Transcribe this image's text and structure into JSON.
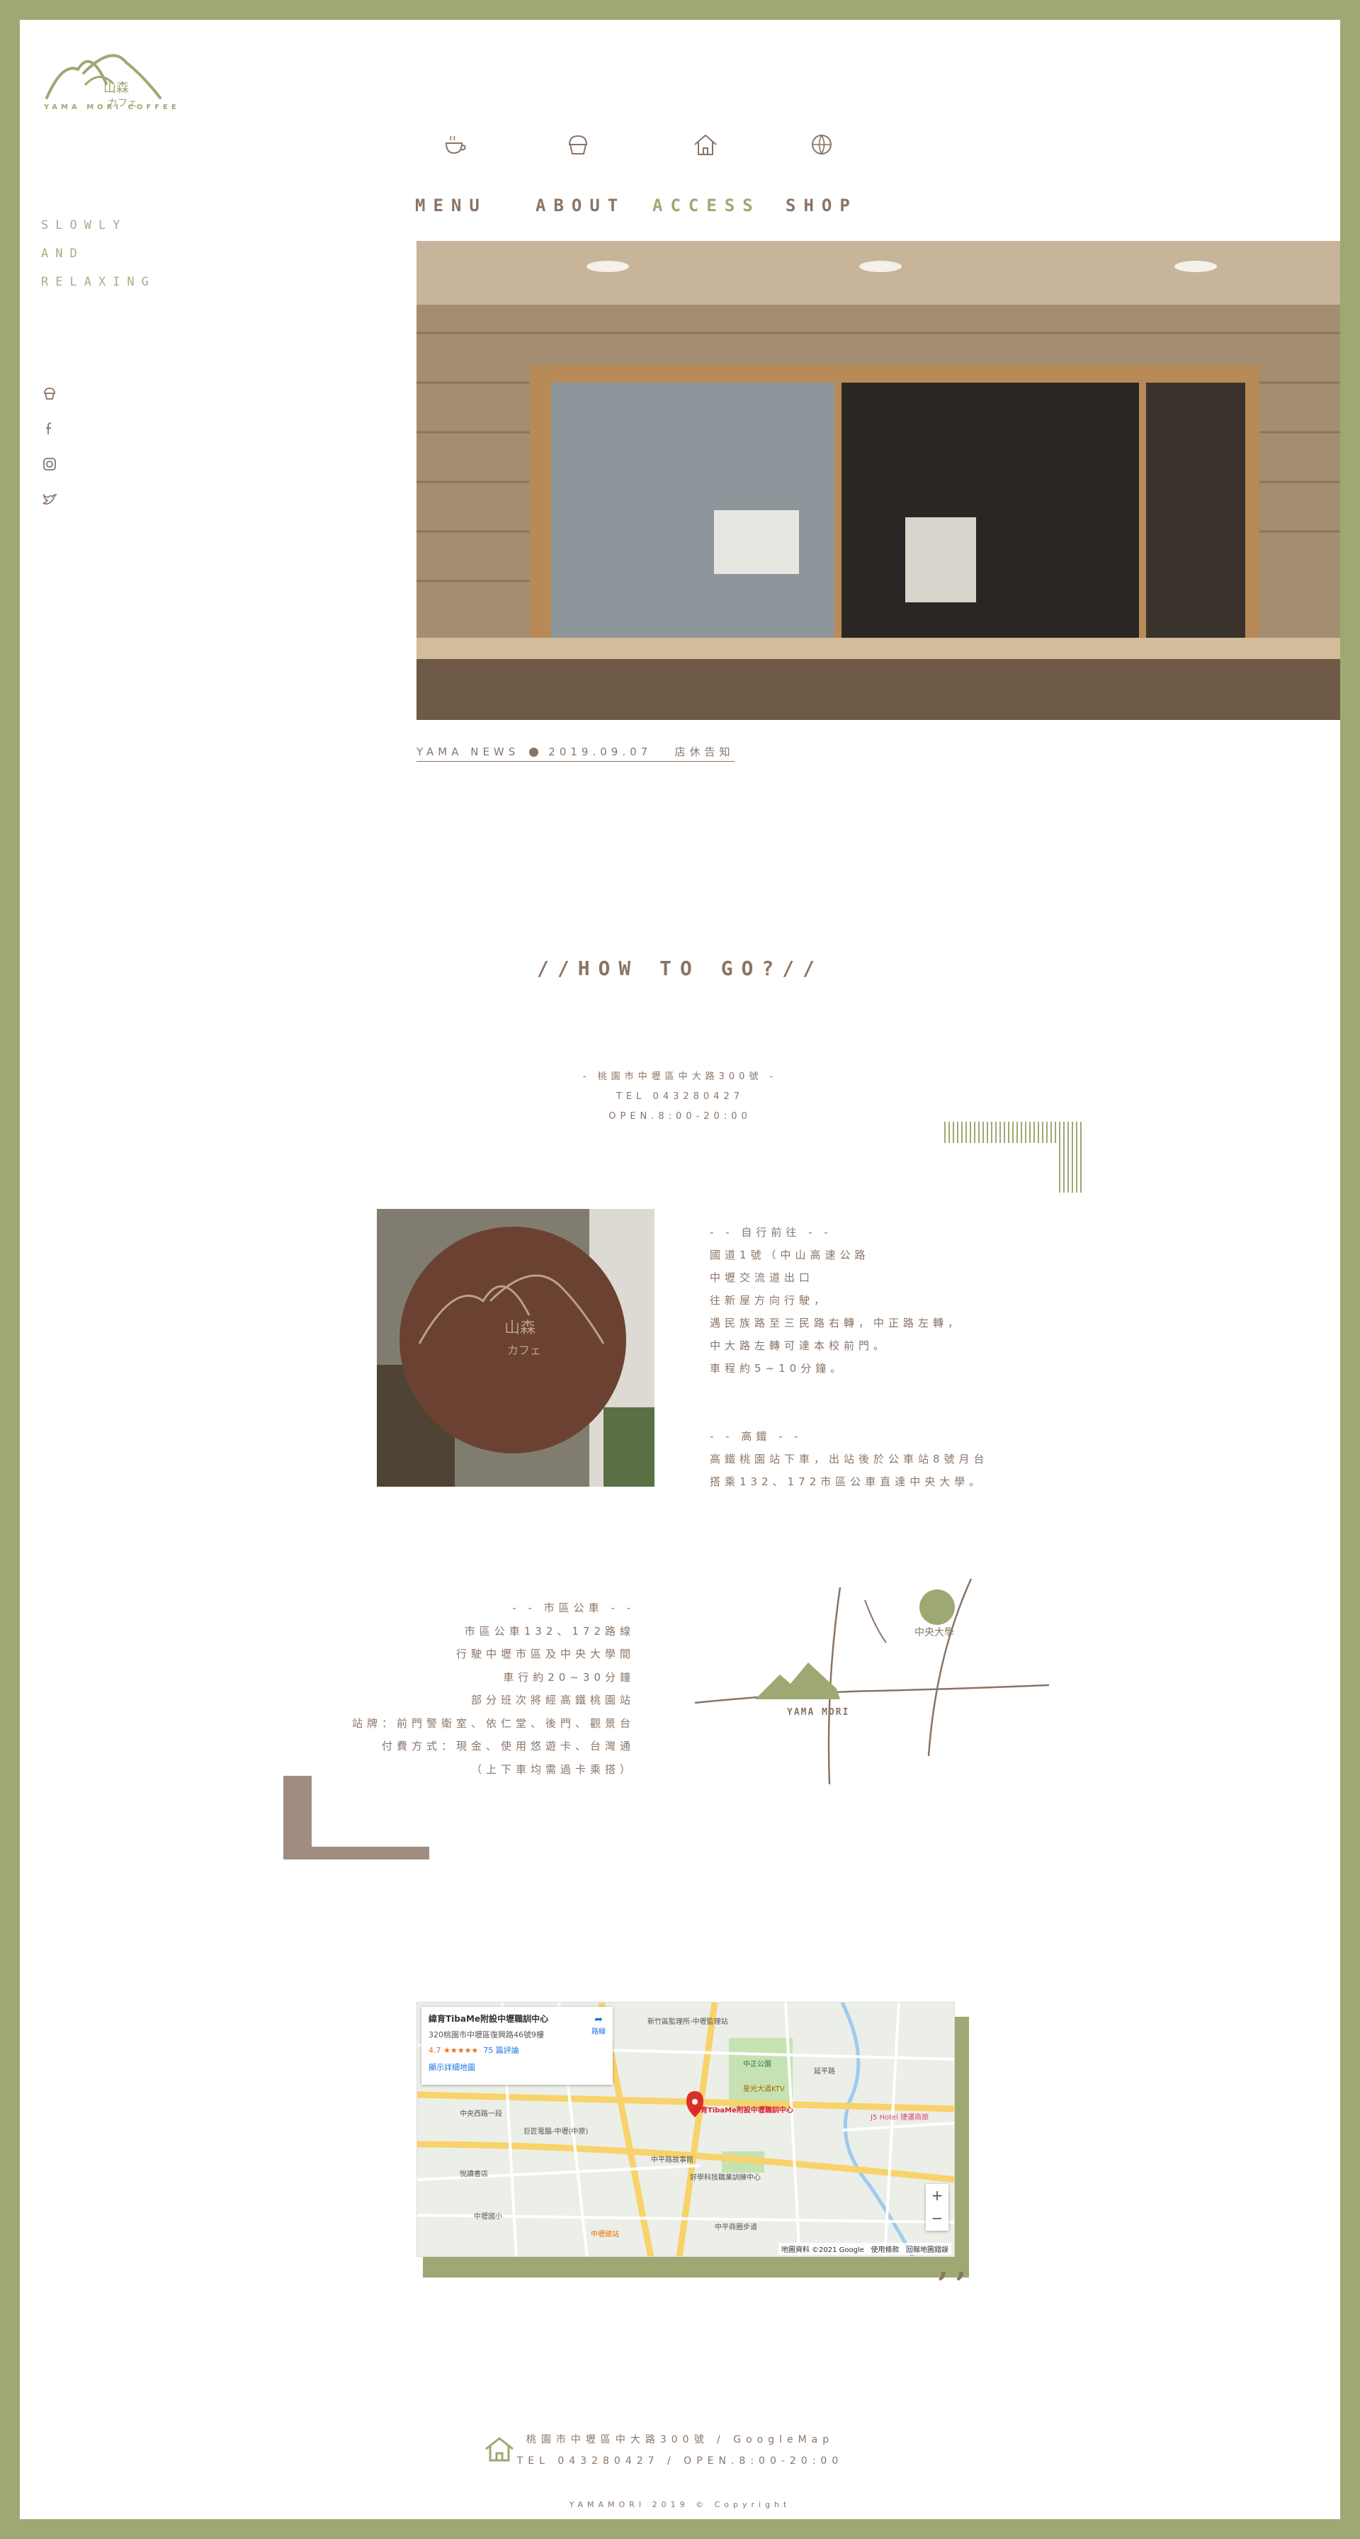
{
  "brand": {
    "logo_kanji": "山森",
    "logo_kana": "カフェ",
    "logo_sub": "YAMA MORI COFFEE"
  },
  "sidebar": {
    "slogan": [
      "SLOWLY",
      "AND",
      "RELAXING"
    ],
    "social": [
      "cupcake-icon",
      "facebook-icon",
      "instagram-icon",
      "twitter-icon"
    ]
  },
  "nav": {
    "items": [
      {
        "label": "MENU",
        "icon": "coffee-cup-icon"
      },
      {
        "label": "ABOUT",
        "icon": "cupcake-icon"
      },
      {
        "label": "ACCESS",
        "icon": "home-icon",
        "active": true
      },
      {
        "label": "SHOP",
        "icon": "globe-icon"
      }
    ]
  },
  "news": {
    "label": "YAMA NEWS",
    "date": "2019.09.07",
    "title": "店休告知"
  },
  "access": {
    "heading": "//HOW TO GO?//",
    "address": "- 桃園市中壢區中大路300號 -",
    "tel": "TEL 043280427",
    "open": "OPEN.8:00-20:00",
    "self_drive": {
      "heading": "- - 自行前往 - -",
      "lines": [
        "國道1號（中山高速公路",
        "中壢交流道出口",
        "往新屋方向行駛，",
        "遇民族路至三民路右轉，中正路左轉，",
        "中大路左轉可達本校前門。",
        "車程約5~10分鐘。"
      ]
    },
    "hsr": {
      "heading": "- - 高鐵 - -",
      "lines": [
        "高鐵桃園站下車，出站後於公車站8號月台",
        "搭乘132、172市區公車直達中央大學。"
      ]
    },
    "bus": {
      "heading": "- - 市區公車 - -",
      "lines": [
        "市區公車132、172路線",
        "行駛中壢市區及中央大學間",
        "車行約20~30分鐘",
        "部分班次將經高鐵桃園站",
        "站牌：前門警衛室、依仁堂、後門、觀景台",
        "付費方式：現金、使用悠遊卡、台灣通",
        "（上下車均需過卡乘搭）"
      ]
    },
    "sketch": {
      "station": "中央大學",
      "shop": "YAMA MORI"
    }
  },
  "map": {
    "place_name": "緯育TibaMe附設中壢職訓中心",
    "place_address": "320桃園市中壢區復興路46號9樓",
    "rating": "4.7 ★★★★★",
    "reviews": "75 篇評論",
    "directions": "路線",
    "more_link": "顯示詳細地圖",
    "pin_label": "緯育TibaMe附設中壢職訓中心",
    "attribution": "地圖資料 ©2021 Google",
    "terms": "使用條款",
    "report": "回報地圖錯誤",
    "zoom_in": "+",
    "zoom_out": "−",
    "labels": [
      "新竹區監理所-中壢監理站",
      "中正公園",
      "中平路故事館",
      "星光大道KTV",
      "好學科技職業訓練中心",
      "中壢國小",
      "巨匠電腦-中壢(中原)",
      "悅讀書店",
      "中壢總站",
      "中央西路一段",
      "延平路",
      "J5 Hotel 捷運商旅",
      "中平商圈步道"
    ]
  },
  "quote_mark": "’’",
  "footer": {
    "line1": "桃園市中壢區中大路300號 / GoogleMap",
    "line2": "TEL 043280427 / OPEN.8:00-20:00",
    "copyright": "YAMAMORI 2019 © Copyright"
  },
  "colors": {
    "olive": "#9fa873",
    "brown": "#8a7466",
    "taupe": "#a08d80"
  }
}
